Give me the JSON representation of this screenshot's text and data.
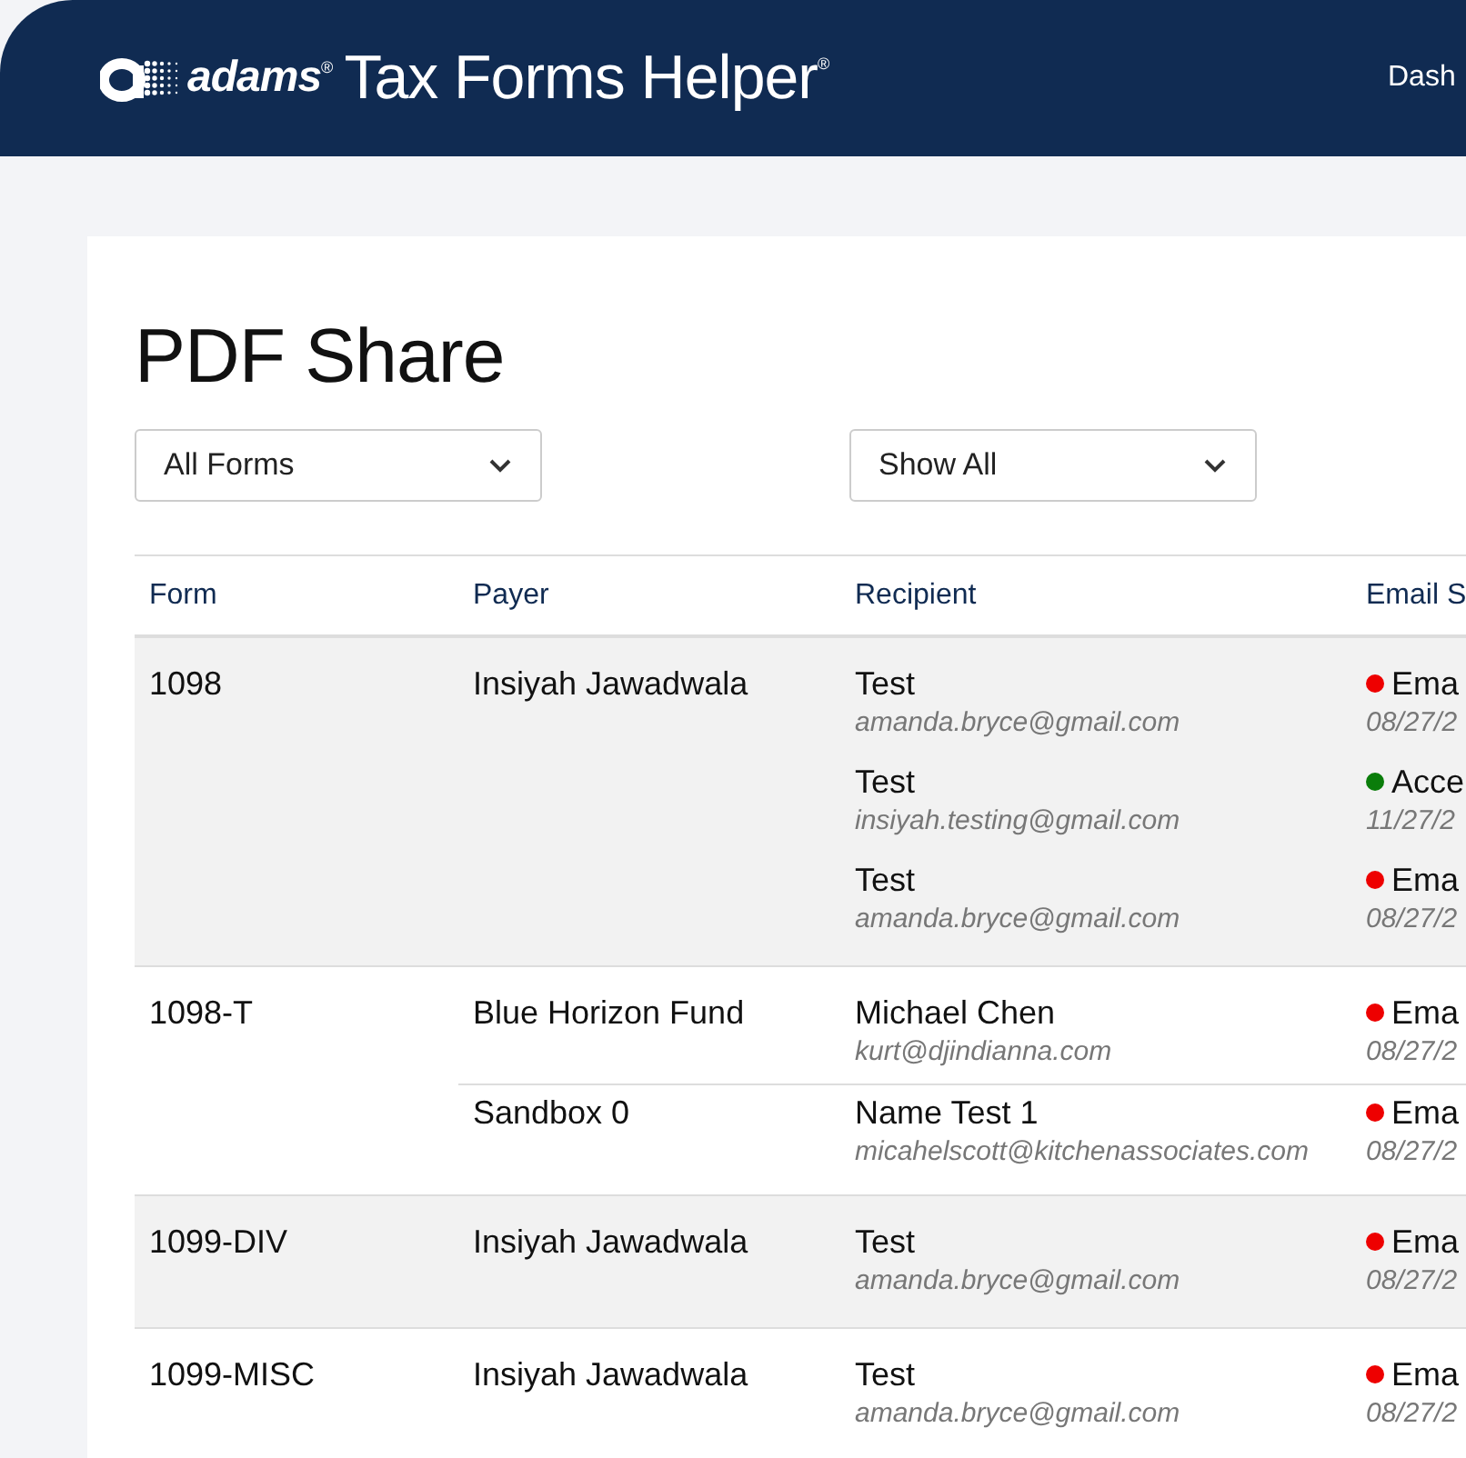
{
  "header": {
    "brand": "adams",
    "brand_mark": "®",
    "product": "Tax Forms Helper",
    "product_mark": "®",
    "nav": [
      "Dash"
    ]
  },
  "page": {
    "title": "PDF Share"
  },
  "filters": [
    {
      "value": "All Forms"
    },
    {
      "value": "Show All"
    }
  ],
  "table": {
    "columns": [
      "Form",
      "Payer",
      "Recipient",
      "Email S"
    ],
    "rows": [
      {
        "form": "1098",
        "groups": [
          {
            "payer": "Insiyah Jawadwala",
            "recipients": [
              {
                "name": "Test",
                "email": "amanda.bryce@gmail.com",
                "status": "Ema",
                "date": "08/27/2",
                "color": "#ee0000"
              },
              {
                "name": "Test",
                "email": "insiyah.testing@gmail.com",
                "status": "Acce",
                "date": "11/27/2",
                "color": "#0a7d0a"
              },
              {
                "name": "Test",
                "email": "amanda.bryce@gmail.com",
                "status": "Ema",
                "date": "08/27/2",
                "color": "#ee0000"
              }
            ]
          }
        ]
      },
      {
        "form": "1098-T",
        "groups": [
          {
            "payer": "Blue Horizon Fund",
            "recipients": [
              {
                "name": "Michael Chen",
                "email": "kurt@djindianna.com",
                "status": "Ema",
                "date": "08/27/2",
                "color": "#ee0000"
              }
            ]
          },
          {
            "payer": "Sandbox 0",
            "recipients": [
              {
                "name": "Name Test 1",
                "email": "micahelscott@kitchenassociates.com",
                "status": "Ema",
                "date": "08/27/2",
                "color": "#ee0000"
              }
            ]
          }
        ]
      },
      {
        "form": "1099-DIV",
        "groups": [
          {
            "payer": "Insiyah Jawadwala",
            "recipients": [
              {
                "name": "Test",
                "email": "amanda.bryce@gmail.com",
                "status": "Ema",
                "date": "08/27/2",
                "color": "#ee0000"
              }
            ]
          }
        ]
      },
      {
        "form": "1099-MISC",
        "groups": [
          {
            "payer": "Insiyah Jawadwala",
            "recipients": [
              {
                "name": "Test",
                "email": "amanda.bryce@gmail.com",
                "status": "Ema",
                "date": "08/27/2",
                "color": "#ee0000"
              }
            ]
          }
        ]
      }
    ]
  }
}
